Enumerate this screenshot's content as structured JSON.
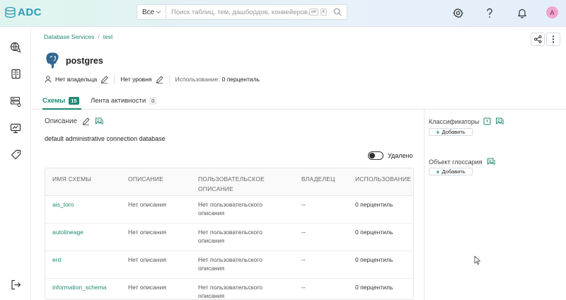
{
  "app": {
    "logo_text": "ADC"
  },
  "search": {
    "scope": "Все",
    "placeholder": "Поиск таблиц, тем, дашбордов, конвейеров, м...",
    "kbd1": "ctrl",
    "kbd2": "K"
  },
  "user": {
    "avatar_letter": "A",
    "avatar_color": "#f0a4cf"
  },
  "breadcrumb": {
    "root": "Database Services",
    "sep": "/",
    "current": "test"
  },
  "database": {
    "name": "postgres",
    "owner": "Нет владельца",
    "tier": "Нет уровня",
    "usage_label": "Использование:",
    "usage_value": "0 перцентиль"
  },
  "tabs": [
    {
      "label": "Схемы",
      "count": "15"
    },
    {
      "label": "Лента активности",
      "count": "0"
    }
  ],
  "description": {
    "label": "Описание",
    "text": "default administrative connection database"
  },
  "deleted_toggle": {
    "label": "Удалено"
  },
  "right_panel": {
    "tags_title": "Классификаторы",
    "glossary_title": "Объект глоссария",
    "add_label": "Добавить"
  },
  "table": {
    "headers": {
      "name": "ИМЯ СХЕМЫ",
      "description": "ОПИСАНИЕ",
      "custom_desc_1": "ПОЛЬЗОВАТЕЛЬСКОЕ",
      "custom_desc_2": "ОПИСАНИЕ",
      "owner": "ВЛАДЕЛЕЦ",
      "usage": "ИСПОЛЬЗОВАНИЕ"
    },
    "rows": [
      {
        "name": "ais_toro",
        "description": "Нет описания",
        "custom_1": "Нет пользовательского",
        "custom_2": "описания",
        "owner": "--",
        "usage": "0 перцентиль"
      },
      {
        "name": "autolineage",
        "description": "Нет описания",
        "custom_1": "Нет пользовательского",
        "custom_2": "описания",
        "owner": "--",
        "usage": "0 перцентиль"
      },
      {
        "name": "erd",
        "description": "Нет описания",
        "custom_1": "Нет пользовательского",
        "custom_2": "описания",
        "owner": "--",
        "usage": "0 перцентиль"
      },
      {
        "name": "information_schema",
        "description": "Нет описания",
        "custom_1": "Нет пользовательского",
        "custom_2": "описания",
        "owner": "--",
        "usage": "0 перцентиль"
      }
    ]
  },
  "colors": {
    "accent": "#1f8a73",
    "logo": "#2a9bb7"
  }
}
